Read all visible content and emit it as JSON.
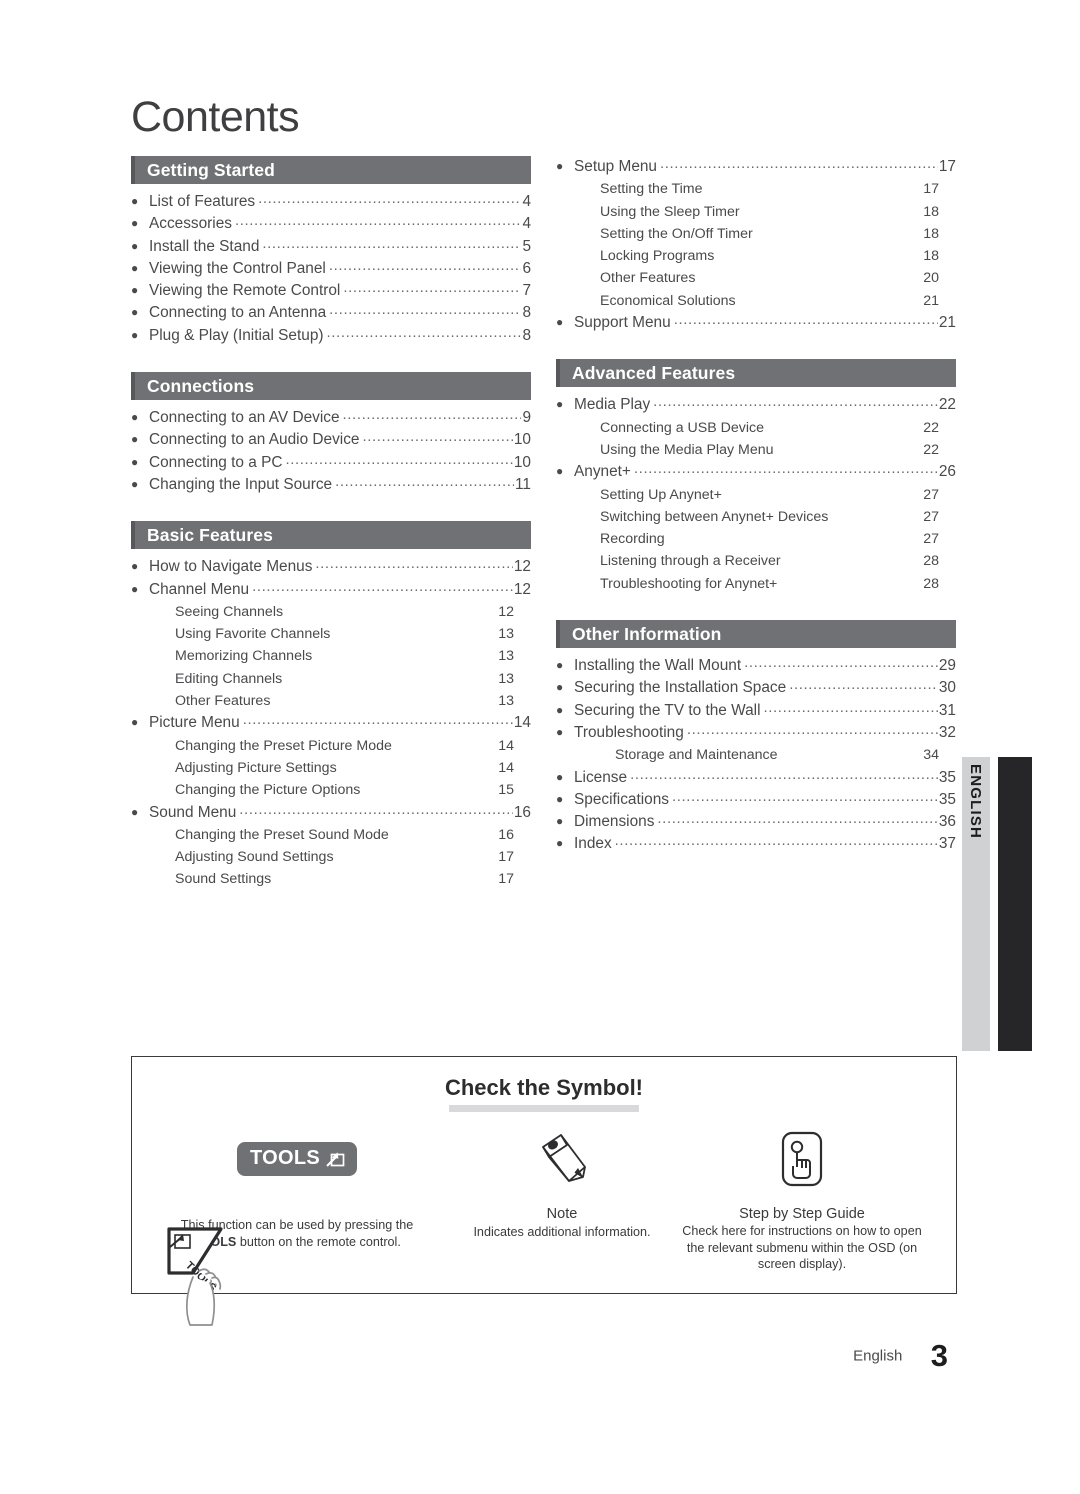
{
  "page": {
    "title": "Contents",
    "footer_label": "English",
    "footer_page": "3",
    "side_tab": "ENGLISH"
  },
  "colors": {
    "section_bar": "#6f7174",
    "section_bar_edge": "#56585b",
    "side_tab": "#d0d1d3",
    "side_bar_black": "#262628",
    "text": "#4a4a4c",
    "underline": "#d9d9db"
  },
  "left_column": [
    {
      "heading": "Getting Started",
      "entries": [
        {
          "type": "main",
          "label": "List of Features",
          "page": "4"
        },
        {
          "type": "main",
          "label": "Accessories",
          "page": "4"
        },
        {
          "type": "main",
          "label": "Install the Stand",
          "page": "5"
        },
        {
          "type": "main",
          "label": "Viewing the Control Panel",
          "page": "6"
        },
        {
          "type": "main",
          "label": "Viewing the Remote Control",
          "page": "7"
        },
        {
          "type": "main",
          "label": "Connecting to an Antenna",
          "page": "8"
        },
        {
          "type": "main",
          "label": "Plug & Play (Initial Setup)",
          "page": "8"
        }
      ]
    },
    {
      "heading": "Connections",
      "entries": [
        {
          "type": "main",
          "label": "Connecting to an AV Device",
          "page": "9"
        },
        {
          "type": "main",
          "label": "Connecting to an Audio Device",
          "page": "10"
        },
        {
          "type": "main",
          "label": "Connecting to a PC",
          "page": "10"
        },
        {
          "type": "main",
          "label": "Changing the Input Source",
          "page": "11"
        }
      ]
    },
    {
      "heading": "Basic Features",
      "entries": [
        {
          "type": "main",
          "label": "How to Navigate Menus",
          "page": "12"
        },
        {
          "type": "main",
          "label": "Channel Menu",
          "page": "12"
        },
        {
          "type": "sub",
          "label": "Seeing Channels",
          "page": "12"
        },
        {
          "type": "sub",
          "label": "Using Favorite Channels",
          "page": "13"
        },
        {
          "type": "sub",
          "label": "Memorizing Channels",
          "page": "13"
        },
        {
          "type": "sub",
          "label": "Editing Channels",
          "page": "13"
        },
        {
          "type": "sub",
          "label": "Other Features",
          "page": "13"
        },
        {
          "type": "main",
          "label": "Picture Menu",
          "page": "14"
        },
        {
          "type": "sub",
          "label": "Changing the Preset Picture Mode",
          "page": "14"
        },
        {
          "type": "sub",
          "label": "Adjusting Picture Settings",
          "page": "14"
        },
        {
          "type": "sub",
          "label": "Changing the Picture Options",
          "page": "15"
        },
        {
          "type": "main",
          "label": "Sound Menu",
          "page": "16"
        },
        {
          "type": "sub",
          "label": "Changing the Preset Sound Mode",
          "page": "16"
        },
        {
          "type": "sub",
          "label": "Adjusting Sound Settings",
          "page": "17"
        },
        {
          "type": "sub",
          "label": "Sound Settings",
          "page": "17"
        }
      ]
    }
  ],
  "right_column": [
    {
      "heading": null,
      "entries": [
        {
          "type": "main",
          "label": "Setup Menu",
          "page": "17"
        },
        {
          "type": "sub",
          "label": "Setting the Time",
          "page": "17"
        },
        {
          "type": "sub",
          "label": "Using the Sleep Timer",
          "page": "18"
        },
        {
          "type": "sub",
          "label": "Setting the On/Off Timer",
          "page": "18"
        },
        {
          "type": "sub",
          "label": "Locking Programs",
          "page": "18"
        },
        {
          "type": "sub",
          "label": "Other Features",
          "page": "20"
        },
        {
          "type": "sub",
          "label": "Economical Solutions",
          "page": "21"
        },
        {
          "type": "main",
          "label": "Support Menu",
          "page": "21"
        }
      ]
    },
    {
      "heading": "Advanced Features",
      "entries": [
        {
          "type": "main",
          "label": "Media Play",
          "page": "22"
        },
        {
          "type": "sub",
          "label": "Connecting a USB Device",
          "page": "22"
        },
        {
          "type": "sub",
          "label": "Using the Media Play Menu",
          "page": "22"
        },
        {
          "type": "main",
          "label": "Anynet+",
          "page": "26"
        },
        {
          "type": "sub",
          "label": "Setting Up Anynet+",
          "page": "27"
        },
        {
          "type": "sub",
          "label": "Switching between Anynet+ Devices",
          "page": "27"
        },
        {
          "type": "sub",
          "label": "Recording",
          "page": "27"
        },
        {
          "type": "sub",
          "label": "Listening through a Receiver",
          "page": "28"
        },
        {
          "type": "sub",
          "label": "Troubleshooting for Anynet+",
          "page": "28"
        }
      ]
    },
    {
      "heading": "Other Information",
      "entries": [
        {
          "type": "main",
          "label": "Installing the Wall Mount",
          "page": "29"
        },
        {
          "type": "main",
          "label": "Securing the Installation Space",
          "page": "30"
        },
        {
          "type": "main",
          "label": "Securing the TV to the Wall",
          "page": "31"
        },
        {
          "type": "main",
          "label": "Troubleshooting",
          "page": "32"
        },
        {
          "type": "sub2",
          "label": "Storage and Maintenance",
          "page": "34"
        },
        {
          "type": "main",
          "label": "License",
          "page": "35"
        },
        {
          "type": "main",
          "label": "Specifications",
          "page": "35"
        },
        {
          "type": "main",
          "label": "Dimensions",
          "page": "36"
        },
        {
          "type": "main",
          "label": "Index",
          "page": "37"
        }
      ]
    }
  ],
  "symbol_box": {
    "title": "Check the Symbol!",
    "items": [
      {
        "icon": "tools-badge-icon",
        "badge_label": "TOOLS",
        "heading": "",
        "body_line1": "This function can be used by pressing the",
        "body_bold": "TOOLS",
        "body_line2": "button on the remote control."
      },
      {
        "icon": "pencil-icon",
        "heading": "Note",
        "body_line1": "Indicates additional information."
      },
      {
        "icon": "step-guide-hand-icon",
        "heading": "Step by Step Guide",
        "body_line1": "Check here for instructions on how to open",
        "body_line2": "the relevant submenu within the OSD (on",
        "body_line3": "screen display)."
      }
    ]
  }
}
